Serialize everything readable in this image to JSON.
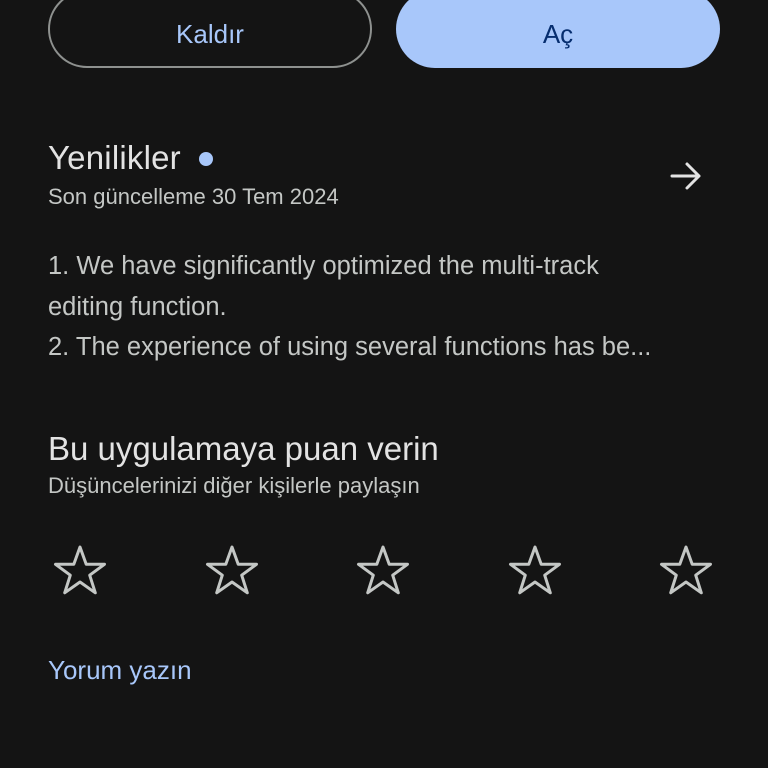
{
  "actions": {
    "uninstall_label": "Kaldır",
    "open_label": "Aç"
  },
  "whats_new": {
    "title": "Yenilikler",
    "updated": "Son güncelleme 30 Tem 2024",
    "lines": [
      "1. We have significantly optimized the multi-track",
      "editing function.",
      "2. The experience of using several functions has be..."
    ],
    "arrow_icon": "arrow-right-icon",
    "dot_color": "#a8c7fa"
  },
  "rate": {
    "title": "Bu uygulamaya puan verin",
    "subtitle": "Düşüncelerinizi diğer kişilerle paylaşın",
    "star_icon": "star-outline-icon",
    "rating": 0,
    "max_rating": 5
  },
  "review": {
    "label": "Yorum yazın"
  },
  "colors": {
    "background": "#141414",
    "accent": "#a8c7fa",
    "on_accent": "#062e6f",
    "text_primary": "#e3e3e3",
    "text_secondary": "#c4c7c5",
    "outline": "#8e918f"
  }
}
